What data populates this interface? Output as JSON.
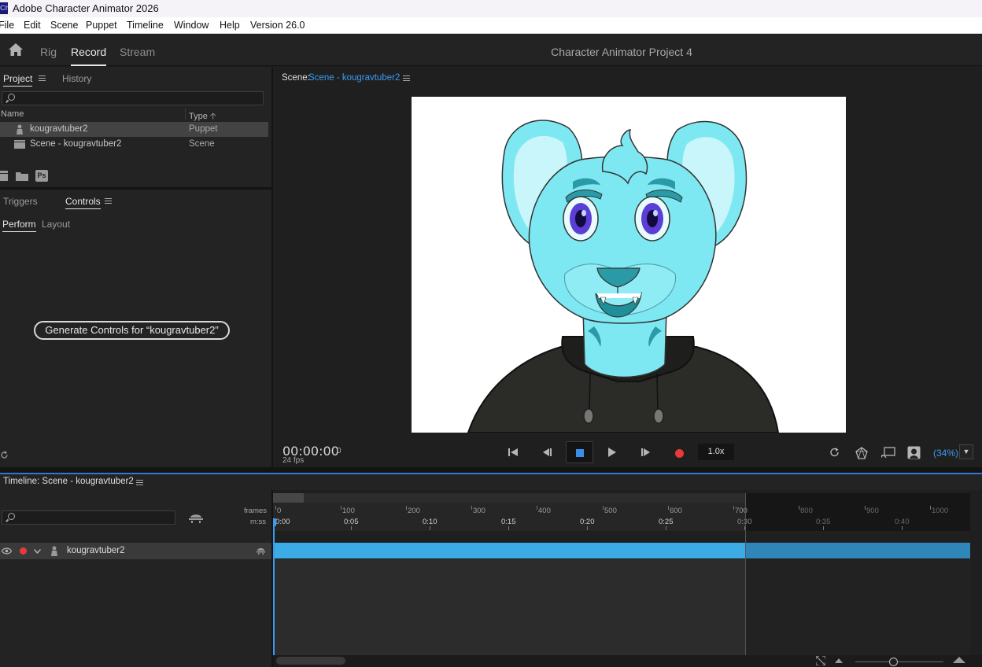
{
  "window": {
    "app_icon_text": "Ch",
    "title": "Adobe Character Animator 2026"
  },
  "menu": [
    "File",
    "Edit",
    "Scene",
    "Puppet",
    "Timeline",
    "Window",
    "Help",
    "Version 26.0"
  ],
  "header": {
    "modes": [
      "Rig",
      "Record",
      "Stream"
    ],
    "active_mode": "Record",
    "project_title": "Character Animator Project 4"
  },
  "project_panel": {
    "tabs": [
      "Project",
      "History"
    ],
    "active_tab": "Project",
    "search_placeholder": "",
    "columns": {
      "name": "Name",
      "type": "Type"
    },
    "items": [
      {
        "name": "kougravtuber2",
        "type": "Puppet",
        "icon": "puppet-icon",
        "selected": true
      },
      {
        "name": "Scene - kougravtuber2",
        "type": "Scene",
        "icon": "scene-icon",
        "selected": false
      }
    ],
    "footer_icons": [
      "new-scene-icon",
      "folder-icon",
      "photoshop-icon"
    ],
    "ps_label": "Ps"
  },
  "controls_panel": {
    "tabs": [
      "Triggers",
      "Controls"
    ],
    "active_tab": "Controls",
    "subtabs": [
      "Perform",
      "Layout"
    ],
    "active_subtab": "Perform",
    "generate_button": "Generate Controls for “kougravtuber2”"
  },
  "scene_panel": {
    "label": "Scene:",
    "scene_name": "Scene - kougravtuber2",
    "timecode": "00:00:00",
    "frame": "0",
    "fps": "24 fps",
    "speed": "1.0x",
    "zoom": "(34%)"
  },
  "timeline": {
    "title": "Timeline: Scene - kougravtuber2",
    "frames_label": "frames",
    "mss_label": "m:ss",
    "frame_ticks": [
      "0",
      "100",
      "200",
      "300",
      "400",
      "500",
      "600",
      "700",
      "800",
      "900",
      "1000"
    ],
    "time_ticks": [
      "0:00",
      "0:05",
      "0:10",
      "0:15",
      "0:20",
      "0:25",
      "0:30",
      "0:35",
      "0:40"
    ],
    "layer_name": "kougravtuber2",
    "search_placeholder": ""
  },
  "colors": {
    "accent_blue": "#3b9bf0",
    "track_blue": "#3cace6",
    "record_red": "#e83a3a",
    "character_cyan": "#7ee8f2"
  }
}
